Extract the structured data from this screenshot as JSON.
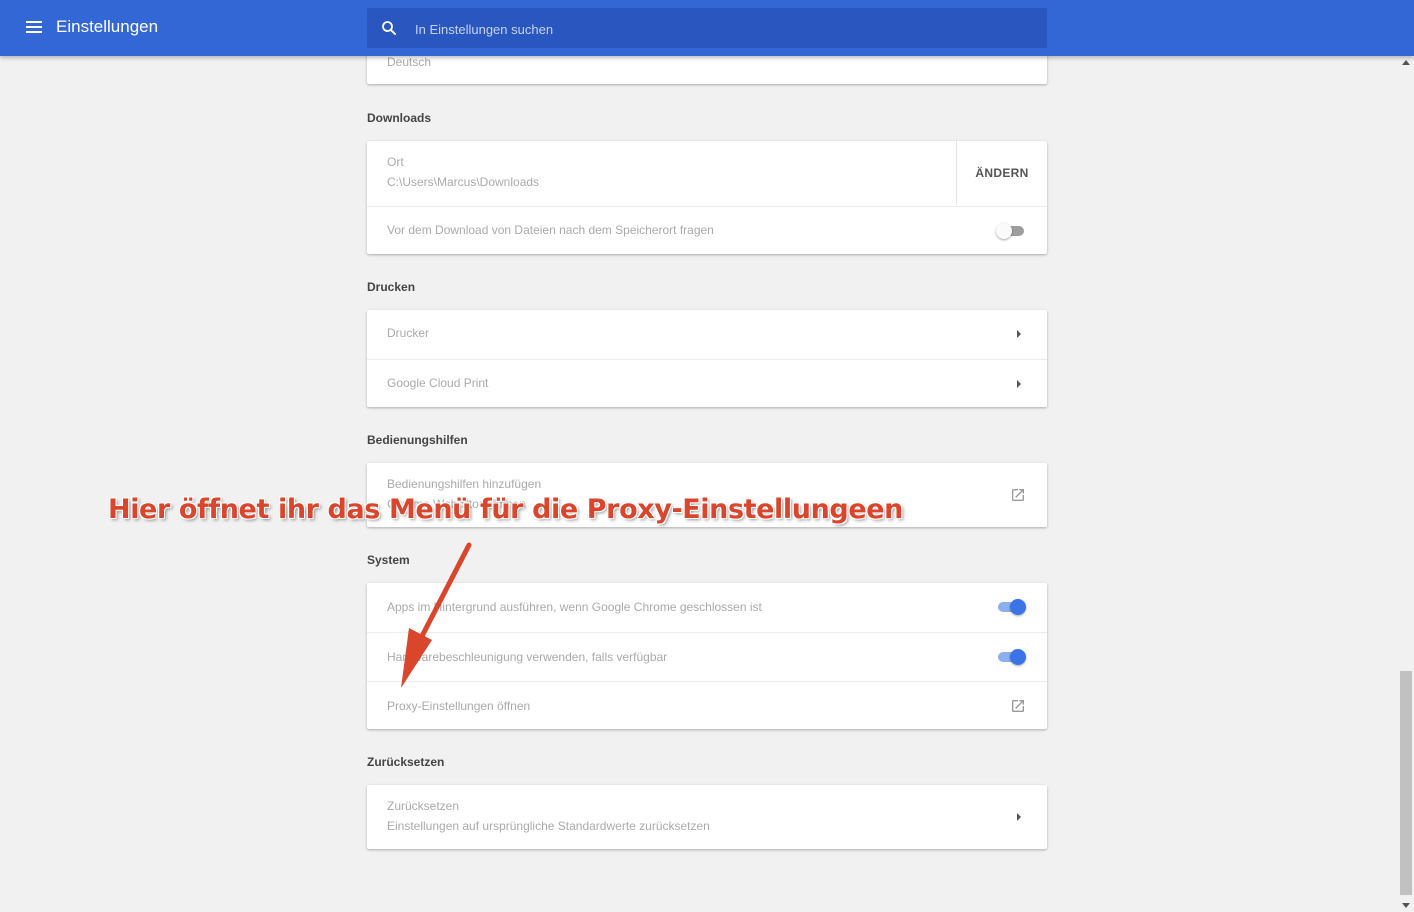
{
  "header": {
    "title": "Einstellungen",
    "search_placeholder": "In Einstellungen suchen"
  },
  "language_card": {
    "value": "Deutsch"
  },
  "downloads": {
    "title": "Downloads",
    "location_label": "Ort",
    "location_path": "C:\\Users\\Marcus\\Downloads",
    "change_button": "ÄNDERN",
    "ask_label": "Vor dem Download von Dateien nach dem Speicherort fragen",
    "ask_enabled": false
  },
  "printing": {
    "title": "Drucken",
    "items": [
      {
        "label": "Drucker"
      },
      {
        "label": "Google Cloud Print"
      }
    ]
  },
  "accessibility": {
    "title": "Bedienungshilfen",
    "add_label": "Bedienungshilfen hinzufügen",
    "add_sub": "Chrome Web Store öffnen"
  },
  "system": {
    "title": "System",
    "background_apps_label": "Apps im Hintergrund ausführen, wenn Google Chrome geschlossen ist",
    "background_apps_enabled": true,
    "hw_accel_label": "Hardwarebeschleunigung verwenden, falls verfügbar",
    "hw_accel_enabled": true,
    "proxy_label": "Proxy-Einstellungen öffnen"
  },
  "reset": {
    "title": "Zurücksetzen",
    "label": "Zurücksetzen",
    "sub": "Einstellungen auf ursprüngliche Standardwerte zurücksetzen"
  },
  "annotation": {
    "text": "Hier öffnet ihr das Menü für die Proxy-Einstellungeen",
    "color": "#d9462c"
  },
  "colors": {
    "header_blue": "#3367d6",
    "toggle_on": "#3b74e6"
  }
}
